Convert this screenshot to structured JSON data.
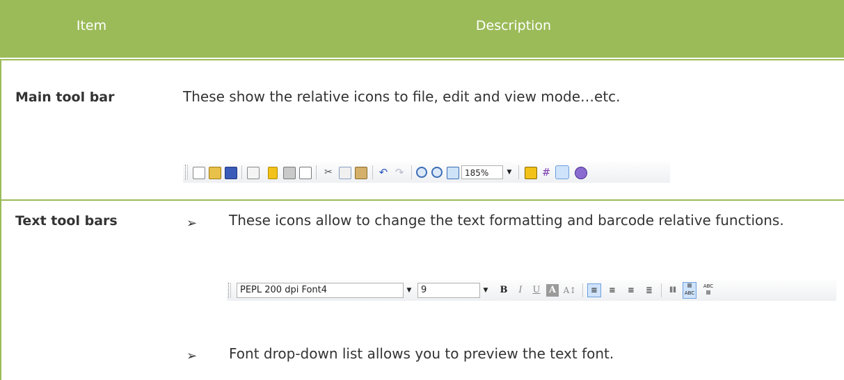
{
  "header": {
    "item": "Item",
    "description": "Description"
  },
  "rows": [
    {
      "label": "Main tool bar",
      "description": "These show the relative icons to file, edit and view mode…etc.",
      "toolbar": {
        "zoom_value": "185%",
        "icons": [
          "new-file-icon",
          "open-folder-icon",
          "save-icon",
          "page-setup-icon",
          "database-icon",
          "print-icon",
          "print-preview-icon",
          "cut-icon",
          "copy-icon",
          "paste-icon",
          "undo-icon",
          "redo-icon",
          "zoom-in-icon",
          "zoom-out-icon",
          "fit-page-icon",
          "ruler-icon",
          "grid-icon",
          "select-pointer-icon",
          "object-icon"
        ]
      }
    },
    {
      "label": "Text tool bars",
      "bullet": "➢",
      "items": [
        "These icons allow to change the text formatting and barcode relative functions.",
        "Font drop-down list allows you to preview the text font."
      ],
      "toolbar": {
        "font_value": "PEPL 200 dpi Font4",
        "size_value": "9",
        "bold": "B",
        "italic": "I",
        "underline": "U",
        "shade": "A",
        "size_adjust": "A↕",
        "barcode_text_below": "ABC",
        "barcode_text_above": "ABC"
      }
    }
  ],
  "colors": {
    "header_bg": "#9bbb59",
    "header_text": "#ffffff",
    "body_text": "#333333"
  }
}
